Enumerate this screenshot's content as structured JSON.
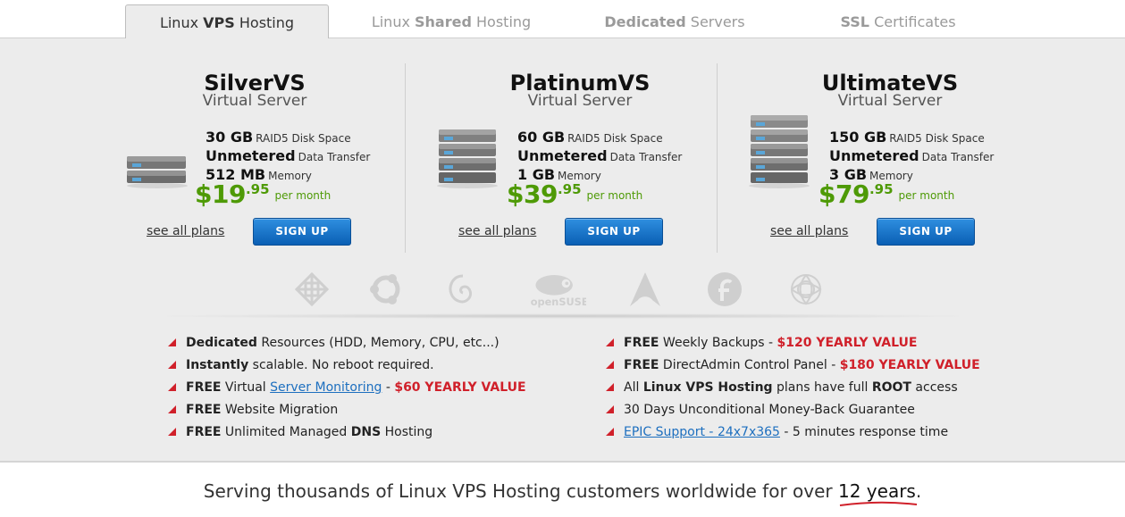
{
  "tabs": [
    {
      "pre": "Linux ",
      "bold": "VPS",
      "post": " Hosting"
    },
    {
      "pre": "Linux ",
      "bold": "Shared",
      "post": " Hosting"
    },
    {
      "pre": "",
      "bold": "Dedicated",
      "post": " Servers"
    },
    {
      "pre": "",
      "bold": "SSL",
      "post": " Certificates"
    }
  ],
  "plans": [
    {
      "name": "SilverVS",
      "subtitle": "Virtual Server",
      "disk": "30 GB",
      "disk_label": "RAID5 Disk Space",
      "transfer": "Unmetered",
      "transfer_label": "Data Transfer",
      "memory": "512 MB",
      "memory_label": "Memory",
      "price_dollars": "$19",
      "price_cents": ".95",
      "price_period": "per month",
      "see_all": "see all plans",
      "signup": "SIGN UP"
    },
    {
      "name": "PlatinumVS",
      "subtitle": "Virtual Server",
      "disk": "60 GB",
      "disk_label": "RAID5 Disk Space",
      "transfer": "Unmetered",
      "transfer_label": "Data Transfer",
      "memory": "1 GB",
      "memory_label": "Memory",
      "price_dollars": "$39",
      "price_cents": ".95",
      "price_period": "per month",
      "see_all": "see all plans",
      "signup": "SIGN UP"
    },
    {
      "name": "UltimateVS",
      "subtitle": "Virtual Server",
      "disk": "150 GB",
      "disk_label": "RAID5 Disk Space",
      "transfer": "Unmetered",
      "transfer_label": "Data Transfer",
      "memory": "3 GB",
      "memory_label": "Memory",
      "price_dollars": "$79",
      "price_cents": ".95",
      "price_period": "per month",
      "see_all": "see all plans",
      "signup": "SIGN UP"
    }
  ],
  "os_icons": [
    "centos-icon",
    "ubuntu-icon",
    "debian-icon",
    "opensuse-icon",
    "arch-icon",
    "fedora-icon",
    "gentoo-icon"
  ],
  "os_opensuse_text": "openSUSE",
  "features_left": [
    {
      "b1": "Dedicated",
      "t1": " Resources (HDD, Memory, CPU, etc...)"
    },
    {
      "b1": "Instantly",
      "t1": " scalable. No reboot required."
    },
    {
      "b1": "FREE",
      "t1": " Virtual ",
      "link": "Server Monitoring",
      "t2": " - ",
      "value": "$60 YEARLY VALUE"
    },
    {
      "b1": "FREE",
      "t1": " Website Migration"
    },
    {
      "b1": "FREE",
      "t1": " Unlimited Managed ",
      "b2": "DNS",
      "t2": " Hosting"
    }
  ],
  "features_right": [
    {
      "b1": "FREE",
      "t1": " Weekly Backups - ",
      "value": "$120 YEARLY VALUE"
    },
    {
      "b1": "FREE",
      "t1": " DirectAdmin Control Panel - ",
      "value": "$180 YEARLY VALUE"
    },
    {
      "t0": "All ",
      "b1": "Linux VPS Hosting",
      "t1": " plans have full ",
      "b2": "ROOT",
      "t2": " access"
    },
    {
      "t0": "30 Days Unconditional Money-Back Guarantee"
    },
    {
      "link": "EPIC Support - 24x7x365",
      "t2": " - 5 minutes response time"
    }
  ],
  "footer": {
    "text": "Serving thousands of Linux VPS Hosting customers worldwide for over ",
    "years": "12 years",
    "end": "."
  },
  "colors": {
    "price_green": "#4e9a06",
    "value_red": "#d0202a",
    "button_blue": "#1a73c9",
    "link_blue": "#1d6fbf"
  }
}
